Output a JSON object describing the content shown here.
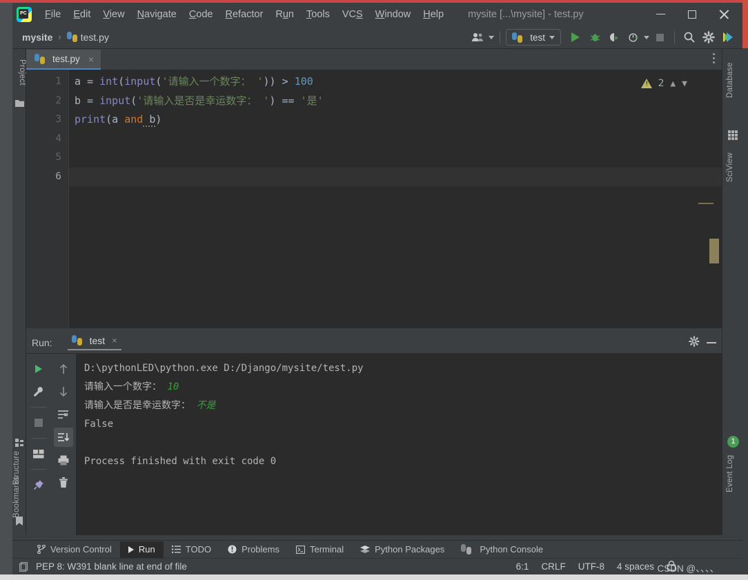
{
  "window": {
    "title": "mysite [...\\mysite] - test.py",
    "minimize_label": "Minimize",
    "maximize_label": "Maximize",
    "close_label": "Close",
    "logo_text": "PC"
  },
  "menu": {
    "items": [
      {
        "label": "File",
        "mnemonic": "F"
      },
      {
        "label": "Edit",
        "mnemonic": "E"
      },
      {
        "label": "View",
        "mnemonic": "V"
      },
      {
        "label": "Navigate",
        "mnemonic": "N"
      },
      {
        "label": "Code",
        "mnemonic": "C"
      },
      {
        "label": "Refactor",
        "mnemonic": "R"
      },
      {
        "label": "Run",
        "mnemonic": "u"
      },
      {
        "label": "Tools",
        "mnemonic": "T"
      },
      {
        "label": "VCS",
        "mnemonic": "S"
      },
      {
        "label": "Window",
        "mnemonic": "W"
      },
      {
        "label": "Help",
        "mnemonic": "H"
      }
    ]
  },
  "navbar": {
    "breadcrumb": [
      "mysite",
      "test.py"
    ],
    "separator": "›",
    "run_config": "test",
    "icons": {
      "user_group": "user-group-icon",
      "run": "run-icon",
      "debug": "debug-icon",
      "coverage": "coverage-icon",
      "profile": "profile-icon",
      "stop": "stop-icon",
      "search": "search-icon",
      "settings": "gear-icon",
      "assistant": "assistant-icon"
    }
  },
  "left_strip": {
    "tabs": [
      "Project",
      "Structure",
      "Bookmarks"
    ]
  },
  "right_strip": {
    "tabs": [
      "Database",
      "SciView",
      "Event Log"
    ],
    "event_log_badge": "1"
  },
  "editor": {
    "tab_label": "test.py",
    "tab_close": "×",
    "warning_count": "2",
    "line_numbers": [
      "1",
      "2",
      "3",
      "4",
      "5",
      "6"
    ],
    "current_line": 6,
    "lines": [
      {
        "n": 1,
        "tokens": [
          {
            "t": "a ",
            "c": "plain"
          },
          {
            "t": "= ",
            "c": "op"
          },
          {
            "t": "int",
            "c": "builtin"
          },
          {
            "t": "(",
            "c": "plain"
          },
          {
            "t": "input",
            "c": "builtin"
          },
          {
            "t": "(",
            "c": "plain"
          },
          {
            "t": "'请输入一个数字： '",
            "c": "str"
          },
          {
            "t": ")) ",
            "c": "plain"
          },
          {
            "t": "> ",
            "c": "op"
          },
          {
            "t": "100",
            "c": "num"
          }
        ]
      },
      {
        "n": 2,
        "tokens": [
          {
            "t": "b ",
            "c": "plain"
          },
          {
            "t": "= ",
            "c": "op"
          },
          {
            "t": "input",
            "c": "builtin"
          },
          {
            "t": "(",
            "c": "plain"
          },
          {
            "t": "'请输入是否是幸运数字： '",
            "c": "str"
          },
          {
            "t": ") ",
            "c": "plain"
          },
          {
            "t": "== ",
            "c": "op"
          },
          {
            "t": "'是'",
            "c": "str"
          }
        ]
      },
      {
        "n": 3,
        "tokens": [
          {
            "t": "print",
            "c": "builtin"
          },
          {
            "t": "(a ",
            "c": "plain"
          },
          {
            "t": "and",
            "c": "kw"
          },
          {
            "t": " b",
            "c": "plain"
          },
          {
            "t": ")",
            "c": "plain"
          }
        ]
      },
      {
        "n": 4,
        "tokens": []
      },
      {
        "n": 5,
        "tokens": []
      },
      {
        "n": 6,
        "tokens": []
      }
    ]
  },
  "run_window": {
    "title": "Run:",
    "tab_label": "test",
    "tab_close": "×",
    "gear_label": "Settings",
    "minimize_label": "Hide",
    "toolbar_icons_left": [
      "rerun-icon",
      "wrench-icon",
      "stop-icon",
      "layout-icon",
      "pin-icon"
    ],
    "toolbar_icons_right": [
      "arrow-up-icon",
      "arrow-down-icon",
      "soft-wrap-icon",
      "scroll-to-end-icon",
      "print-icon",
      "trash-icon"
    ],
    "console": [
      {
        "text": "D:\\pythonLED\\python.exe D:/Django/mysite/test.py",
        "input": ""
      },
      {
        "text": "请输入一个数字：",
        "input": "10"
      },
      {
        "text": "请输入是否是幸运数字：",
        "input": "不是"
      },
      {
        "text": "False",
        "input": ""
      },
      {
        "text": "",
        "input": ""
      },
      {
        "text": "Process finished with exit code 0",
        "input": ""
      }
    ]
  },
  "bottom_tabs": [
    {
      "label": "Version Control",
      "icon": "branch-icon",
      "active": false
    },
    {
      "label": "Run",
      "icon": "run-icon",
      "active": true
    },
    {
      "label": "TODO",
      "icon": "list-icon",
      "active": false
    },
    {
      "label": "Problems",
      "icon": "warning-circle-icon",
      "active": false
    },
    {
      "label": "Terminal",
      "icon": "terminal-icon",
      "active": false
    },
    {
      "label": "Python Packages",
      "icon": "packages-icon",
      "active": false
    },
    {
      "label": "Python Console",
      "icon": "python-icon",
      "active": false
    }
  ],
  "statusbar": {
    "message": "PEP 8: W391 blank line at end of file",
    "caret": "6:1",
    "line_separator": "CRLF",
    "encoding": "UTF-8",
    "indent": "4 spaces",
    "watermark": "CSDN @、、、、",
    "lock_icon": "lock-icon"
  },
  "colors": {
    "bg": "#3c3f41",
    "editor_bg": "#2b2b2b",
    "accent": "#4a88c7",
    "string": "#6a8759",
    "number": "#6897bb",
    "keyword": "#cc7832",
    "builtin": "#8888c6",
    "text": "#a9b7c6",
    "run_green": "#499c54"
  }
}
